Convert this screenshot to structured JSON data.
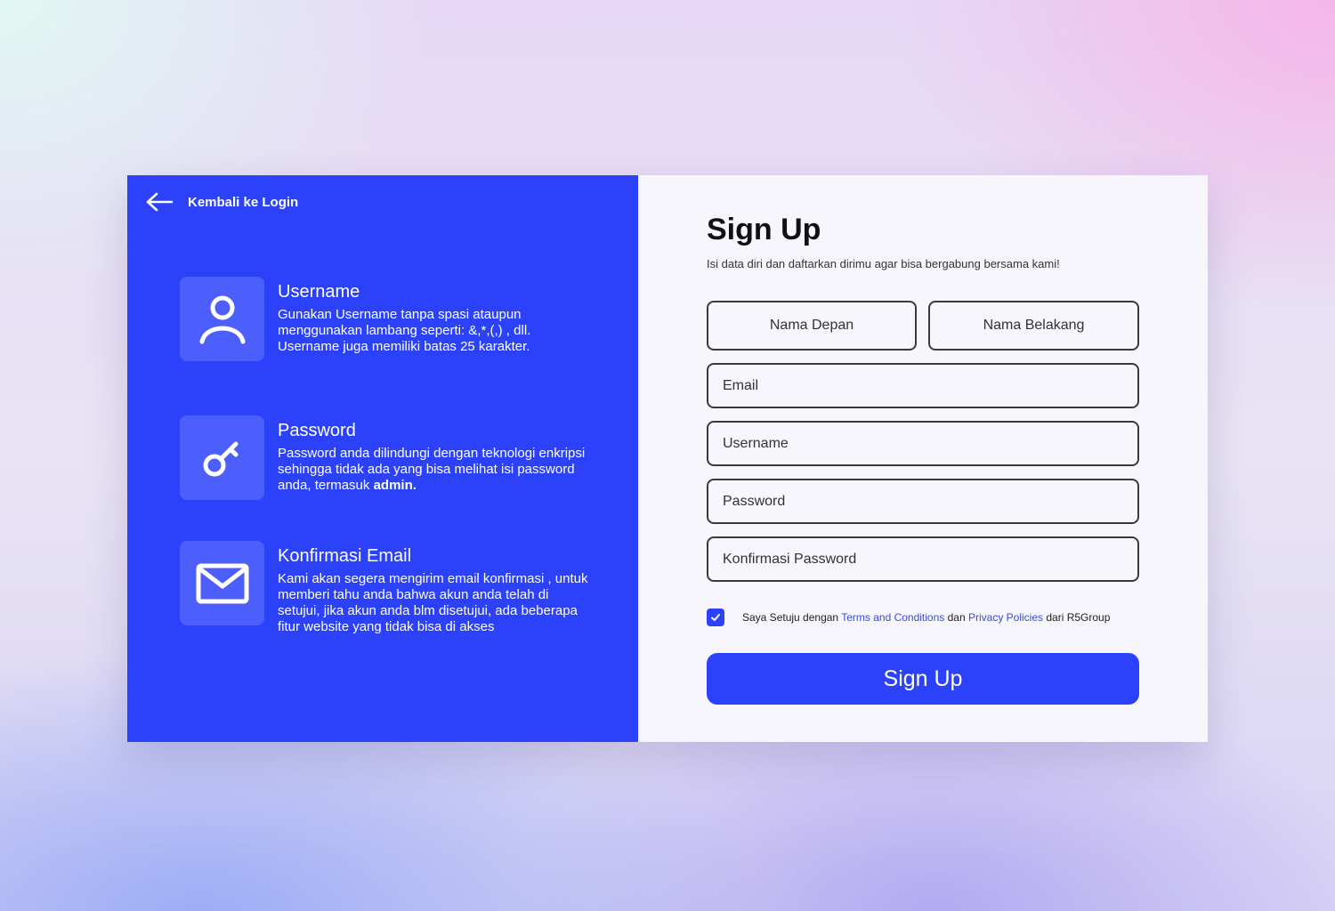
{
  "colors": {
    "accent": "#2b41fa",
    "icon_tile": "#4c5ffc",
    "link": "#3a4bd8"
  },
  "back_link": {
    "label": "Kembali ke Login",
    "icon": "arrow-left-icon"
  },
  "features": [
    {
      "icon": "user-icon",
      "title": "Username",
      "description": "Gunakan Username tanpa spasi ataupun menggunakan lambang seperti: &,*,(,) , dll. Username juga memiliki batas 25 karakter."
    },
    {
      "icon": "key-icon",
      "title": "Password",
      "description": "Password anda dilindungi dengan teknologi enkripsi sehingga tidak ada yang bisa melihat isi password anda, termasuk ",
      "description_bold": "admin."
    },
    {
      "icon": "mail-icon",
      "title": "Konfirmasi Email",
      "description": "Kami akan segera mengirim email konfirmasi , untuk memberi tahu anda bahwa akun anda telah di setujui, jika akun anda blm disetujui, ada beberapa fitur website yang tidak bisa di akses"
    }
  ],
  "form": {
    "title": "Sign Up",
    "subtitle": "Isi data diri dan daftarkan dirimu agar bisa bergabung bersama kami!",
    "fields": {
      "first_name": "Nama Depan",
      "last_name": "Nama Belakang",
      "email": "Email",
      "username": "Username",
      "password": "Password",
      "confirm_password": "Konfirmasi Password"
    },
    "agreement": {
      "checked": true,
      "prefix": "Saya Setuju dengan ",
      "terms": "Terms and Conditions",
      "middle": " dan ",
      "privacy": "Privacy Policies",
      "suffix": " dari R5Group"
    },
    "submit_label": "Sign Up"
  }
}
